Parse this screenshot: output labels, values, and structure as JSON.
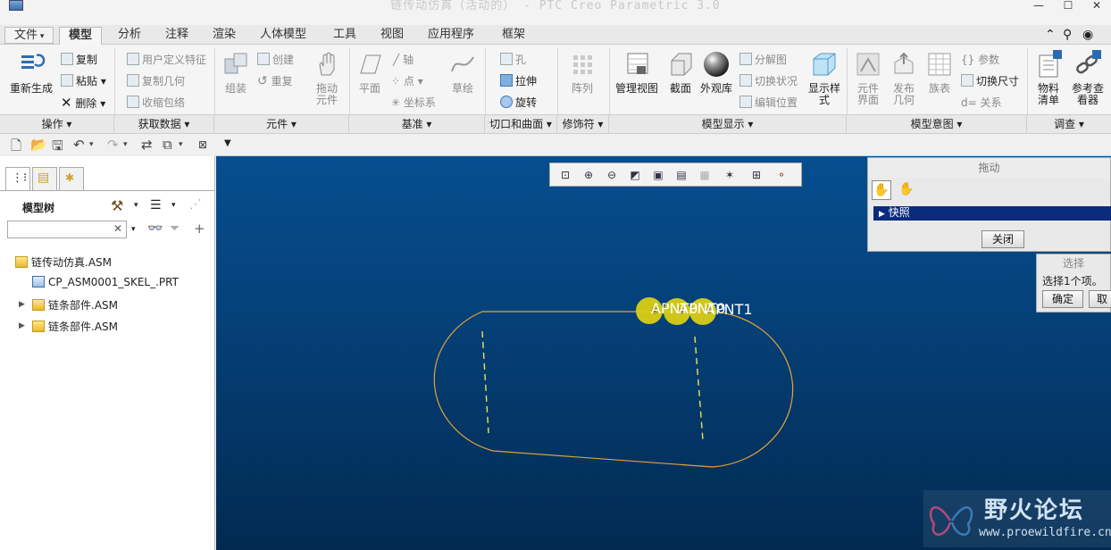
{
  "window": {
    "title": "链传动仿真（活动的） - PTC Creo Parametric 3.0"
  },
  "tabs": [
    {
      "label": "文件",
      "dropdown": true
    },
    {
      "label": "模型",
      "active": true
    },
    {
      "label": "分析"
    },
    {
      "label": "注释"
    },
    {
      "label": "渲染"
    },
    {
      "label": "人体模型"
    },
    {
      "label": "工具"
    },
    {
      "label": "视图"
    },
    {
      "label": "应用程序"
    },
    {
      "label": "框架"
    }
  ],
  "ribbon": {
    "regenerate": "重新生成",
    "copy": "复制",
    "paste": "粘贴",
    "delete": "删除",
    "udf": "用户定义特征",
    "copy_geom": "复制几何",
    "shrinkwrap": "收缩包络",
    "create": "创建",
    "repeat": "重复",
    "assemble": "组装",
    "drag_components_l1": "拖动",
    "drag_components_l2": "元件",
    "plane": "平面",
    "axis": "轴",
    "point": "点",
    "csys": "坐标系",
    "sketch": "草绘",
    "hole": "孔",
    "extrude": "拉伸",
    "revolve": "旋转",
    "pattern": "阵列",
    "manage_views": "管理视图",
    "section": "截面",
    "appearance": "外观库",
    "exploded": "分解图",
    "toggle_status": "切换状况",
    "edit_position": "编辑位置",
    "display_style_l1": "显示样",
    "display_style_l2": "式",
    "comp_interface_l1": "元件",
    "comp_interface_l2": "界面",
    "publish_geom_l1": "发布",
    "publish_geom_l2": "几何",
    "family_table": "族表",
    "params": "参数",
    "switch_dims": "切换尺寸",
    "relations": "关系",
    "bom_l1": "物料",
    "bom_l2": "清单",
    "ref_viewer_l1": "参考查",
    "ref_viewer_l2": "看器"
  },
  "groups": [
    "操作",
    "获取数据",
    "元件",
    "基准",
    "切口和曲面",
    "修饰符",
    "模型显示",
    "模型意图",
    "调查"
  ],
  "model_tree": {
    "title": "模型树",
    "search_placeholder": "",
    "items": [
      {
        "label": "链传动仿真.ASM",
        "type": "asm",
        "level": 0
      },
      {
        "label": "CP_ASM0001_SKEL_.PRT",
        "type": "prt",
        "level": 1
      },
      {
        "label": "链条部件.ASM",
        "type": "asm",
        "level": 1,
        "expandable": true
      },
      {
        "label": "链条部件.ASM",
        "type": "asm",
        "level": 1,
        "expandable": true
      }
    ]
  },
  "drag_dialog": {
    "title": "拖动",
    "snapshot": "快照",
    "close": "关闭"
  },
  "select_dialog": {
    "title": "选择",
    "message": "选择1个项。",
    "ok": "确定",
    "cancel": "取"
  },
  "graphics": {
    "label_a": "APNT0",
    "label_b": "APNT0",
    "label_c": "APNT1"
  },
  "watermark": {
    "title": "野火论坛",
    "url": "www.proewildfire.cn"
  }
}
